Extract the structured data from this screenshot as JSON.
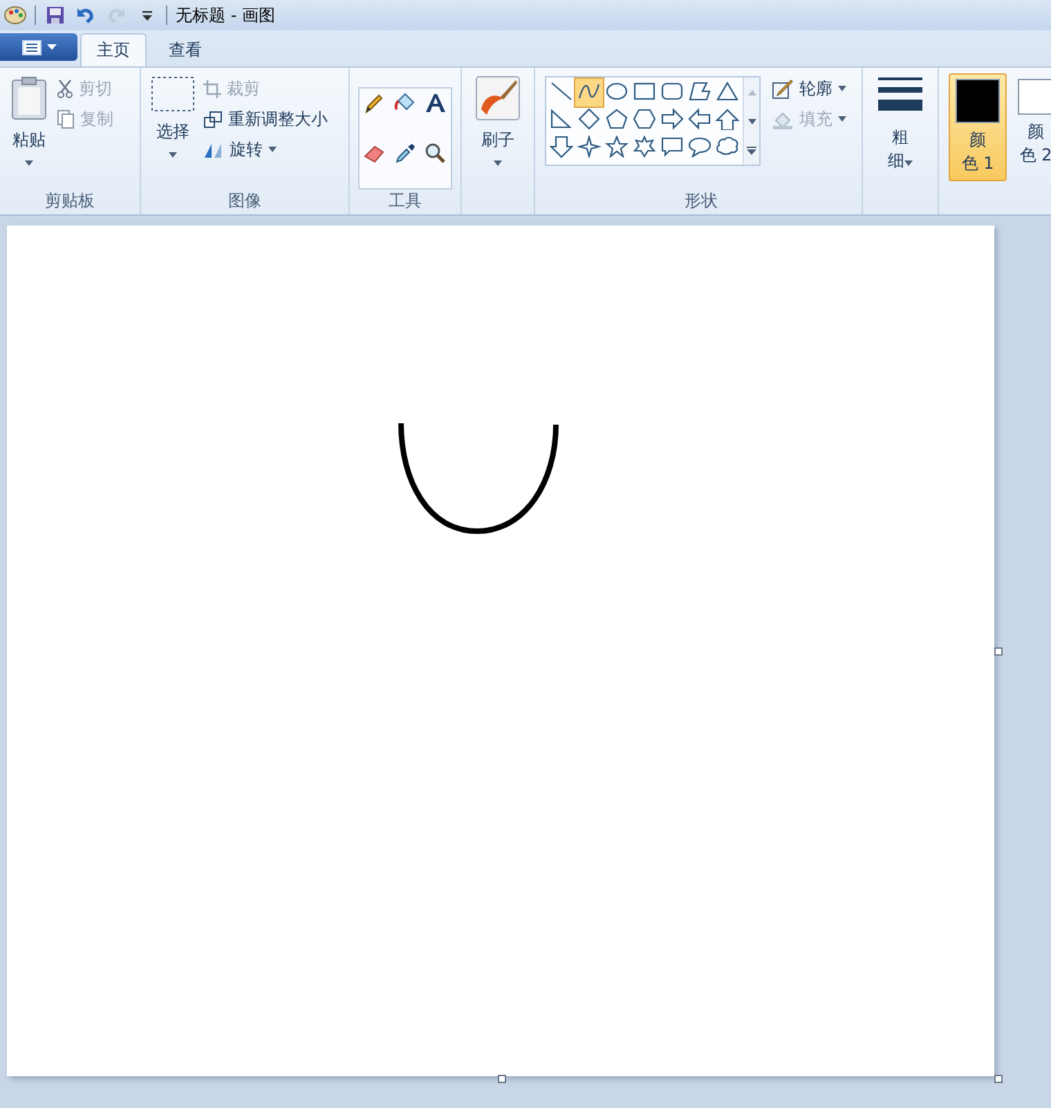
{
  "title_bar": {
    "title": "无标题 - 画图"
  },
  "quick_access": [
    {
      "kind": "save",
      "disabled": false
    },
    {
      "kind": "undo",
      "disabled": false
    },
    {
      "kind": "redo",
      "disabled": true
    },
    {
      "kind": "customize",
      "disabled": false
    }
  ],
  "tabs": [
    {
      "label": "主页",
      "selected": true
    },
    {
      "label": "查看",
      "selected": false
    }
  ],
  "clipboard": {
    "label": "剪贴板",
    "paste": "粘贴",
    "cut": {
      "label": "剪切",
      "disabled": true
    },
    "copy": {
      "label": "复制",
      "disabled": true
    }
  },
  "image": {
    "label": "图像",
    "select": "选择",
    "crop": {
      "label": "裁剪",
      "disabled": true
    },
    "resize": {
      "label": "重新调整大小",
      "disabled": false
    },
    "rotate": {
      "label": "旋转",
      "disabled": false
    }
  },
  "tools": {
    "label": "工具",
    "items": [
      {
        "selected": false
      },
      {
        "selected": false
      },
      {
        "selected": false
      },
      {
        "selected": false
      },
      {
        "selected": false
      },
      {
        "selected": false
      }
    ]
  },
  "brushes": {
    "label": "刷子"
  },
  "shapes": {
    "label": "形状",
    "items": [
      {
        "selected": false
      },
      {
        "selected": true
      },
      {
        "selected": false
      },
      {
        "selected": false
      },
      {
        "selected": false
      },
      {
        "selected": false
      },
      {
        "selected": false
      },
      {
        "selected": false
      },
      {
        "selected": false
      },
      {
        "selected": false
      },
      {
        "selected": false
      },
      {
        "selected": false
      },
      {
        "selected": false
      },
      {
        "selected": false
      },
      {
        "selected": false
      },
      {
        "selected": false
      },
      {
        "selected": false
      },
      {
        "selected": false
      },
      {
        "selected": false
      },
      {
        "selected": false
      },
      {
        "selected": false
      }
    ],
    "outline": {
      "label": "轮廓",
      "disabled": false
    },
    "fill": {
      "label": "填充",
      "disabled": true
    }
  },
  "size": {
    "label_top": "粗",
    "label_bottom": "细"
  },
  "colors": [
    {
      "label_top": "颜",
      "label_bottom": "色 1",
      "color": "#000000",
      "selected": true
    },
    {
      "label_top": "颜",
      "label_bottom": "色 2",
      "color": "#ffffff",
      "selected": false
    }
  ]
}
